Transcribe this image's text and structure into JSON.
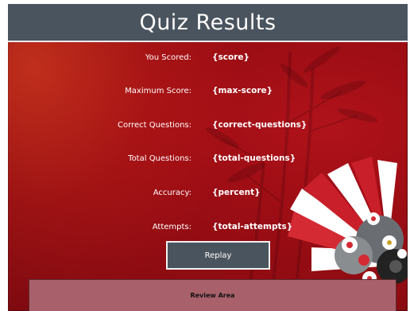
{
  "title": "Quiz Results",
  "rows": [
    {
      "label": "You Scored:",
      "value": "{score}"
    },
    {
      "label": "Maximum Score:",
      "value": "{max-score}"
    },
    {
      "label": "Correct Questions:",
      "value": "{correct-questions}"
    },
    {
      "label": "Total Questions:",
      "value": "{total-questions}"
    },
    {
      "label": "Accuracy:",
      "value": "{percent}"
    },
    {
      "label": "Attempts:",
      "value": "{total-attempts}"
    }
  ],
  "replay_label": "Replay",
  "review_label": "Review Area",
  "colors": {
    "title_bar": "#4a545e",
    "background": "#9c0d14",
    "button": "#4a545e",
    "review_area": "#a8616a"
  },
  "decoration": [
    "bamboo-silhouette",
    "fan-flower-ornament"
  ]
}
